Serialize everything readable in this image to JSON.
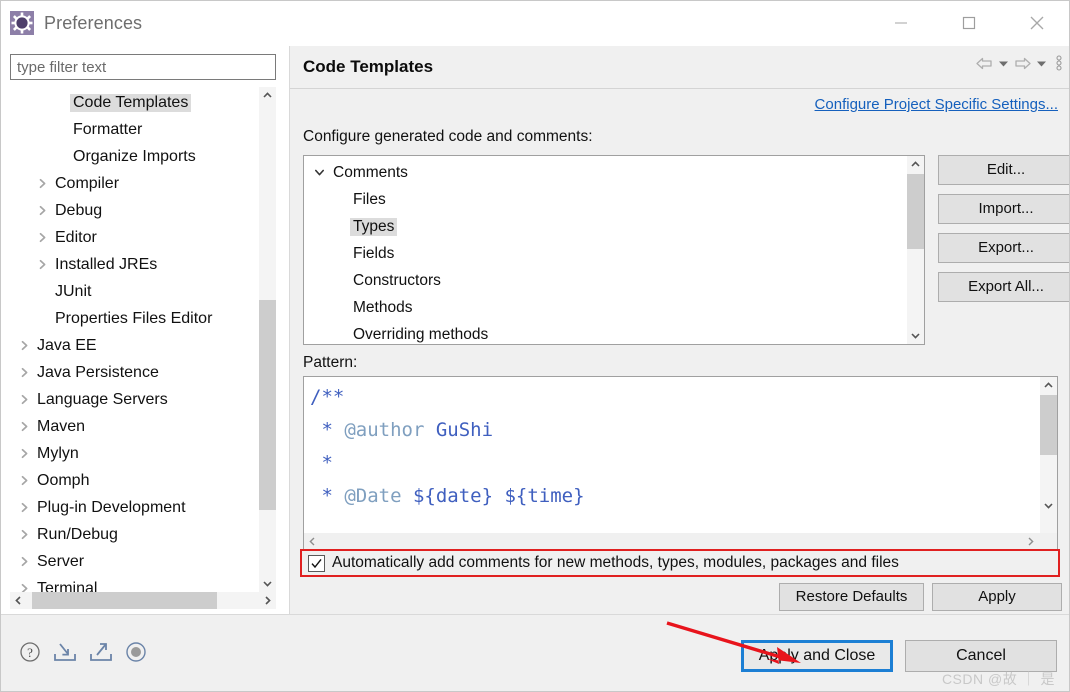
{
  "window": {
    "title": "Preferences",
    "icon": "preferences-gear-icon",
    "controls": [
      {
        "name": "minimize",
        "glyph": "—"
      },
      {
        "name": "maximize",
        "glyph": "□"
      },
      {
        "name": "close",
        "glyph": "✕"
      }
    ]
  },
  "sidebar": {
    "filter": {
      "value": "",
      "placeholder": "type filter text"
    },
    "items": [
      {
        "label": "Code Templates",
        "indent": 2,
        "expandable": false,
        "selected": true
      },
      {
        "label": "Formatter",
        "indent": 2,
        "expandable": false,
        "selected": false
      },
      {
        "label": "Organize Imports",
        "indent": 2,
        "expandable": false,
        "selected": false
      },
      {
        "label": "Compiler",
        "indent": 1,
        "expandable": true,
        "selected": false
      },
      {
        "label": "Debug",
        "indent": 1,
        "expandable": true,
        "selected": false
      },
      {
        "label": "Editor",
        "indent": 1,
        "expandable": true,
        "selected": false
      },
      {
        "label": "Installed JREs",
        "indent": 1,
        "expandable": true,
        "selected": false
      },
      {
        "label": "JUnit",
        "indent": 1,
        "expandable": false,
        "selected": false
      },
      {
        "label": "Properties Files Editor",
        "indent": 1,
        "expandable": false,
        "selected": false
      },
      {
        "label": "Java EE",
        "indent": 0,
        "expandable": true,
        "selected": false
      },
      {
        "label": "Java Persistence",
        "indent": 0,
        "expandable": true,
        "selected": false
      },
      {
        "label": "Language Servers",
        "indent": 0,
        "expandable": true,
        "selected": false
      },
      {
        "label": "Maven",
        "indent": 0,
        "expandable": true,
        "selected": false
      },
      {
        "label": "Mylyn",
        "indent": 0,
        "expandable": true,
        "selected": false
      },
      {
        "label": "Oomph",
        "indent": 0,
        "expandable": true,
        "selected": false
      },
      {
        "label": "Plug-in Development",
        "indent": 0,
        "expandable": true,
        "selected": false
      },
      {
        "label": "Run/Debug",
        "indent": 0,
        "expandable": true,
        "selected": false
      },
      {
        "label": "Server",
        "indent": 0,
        "expandable": true,
        "selected": false
      },
      {
        "label": "Terminal",
        "indent": 0,
        "expandable": true,
        "selected": false
      }
    ]
  },
  "page": {
    "title": "Code Templates",
    "configure_link": "Configure Project Specific Settings...",
    "section_label": "Configure generated code and comments:",
    "templates": [
      {
        "label": "Comments",
        "indent": 0,
        "expanded": true,
        "selected": false
      },
      {
        "label": "Files",
        "indent": 1,
        "expanded": null,
        "selected": false
      },
      {
        "label": "Types",
        "indent": 1,
        "expanded": null,
        "selected": true
      },
      {
        "label": "Fields",
        "indent": 1,
        "expanded": null,
        "selected": false
      },
      {
        "label": "Constructors",
        "indent": 1,
        "expanded": null,
        "selected": false
      },
      {
        "label": "Methods",
        "indent": 1,
        "expanded": null,
        "selected": false
      },
      {
        "label": "Overriding methods",
        "indent": 1,
        "expanded": null,
        "selected": false
      }
    ],
    "side_buttons": [
      {
        "label": "Edit...",
        "name": "edit-button"
      },
      {
        "label": "Import...",
        "name": "import-button"
      },
      {
        "label": "Export...",
        "name": "export-button"
      },
      {
        "label": "Export All...",
        "name": "export-all-button"
      }
    ],
    "pattern_label": "Pattern:",
    "pattern_lines": [
      [
        {
          "t": "/**",
          "cls": ""
        }
      ],
      [
        {
          "t": " * ",
          "cls": ""
        },
        {
          "t": "@author",
          "cls": "tag"
        },
        {
          "t": " GuShi",
          "cls": ""
        }
      ],
      [
        {
          "t": " *",
          "cls": ""
        }
      ],
      [
        {
          "t": " * ",
          "cls": ""
        },
        {
          "t": "@Date",
          "cls": "tag"
        },
        {
          "t": " ${date} ${time}",
          "cls": ""
        }
      ]
    ],
    "pattern_text": "/**\n * @author GuShi\n *\n * @Date ${date} ${time}",
    "auto_comments": {
      "label": "Automatically add comments for new methods, types, modules, packages and files",
      "checked": true
    },
    "restore_defaults_label": "Restore Defaults",
    "apply_label": "Apply"
  },
  "footer": {
    "icons": [
      {
        "name": "help-icon",
        "title": "?"
      },
      {
        "name": "import-preferences-icon",
        "title": "import"
      },
      {
        "name": "export-preferences-icon",
        "title": "export"
      },
      {
        "name": "record-icon",
        "title": "record"
      }
    ],
    "apply_and_close_label": "Apply and Close",
    "cancel_label": "Cancel",
    "watermark": "CSDN @故 ｜ 是"
  },
  "colors": {
    "link": "#1560bd",
    "annotation_red": "#e02020",
    "focus_blue": "#1c7fd4",
    "code_blue": "#3f5fbf",
    "code_tag": "#7f9fbf"
  }
}
